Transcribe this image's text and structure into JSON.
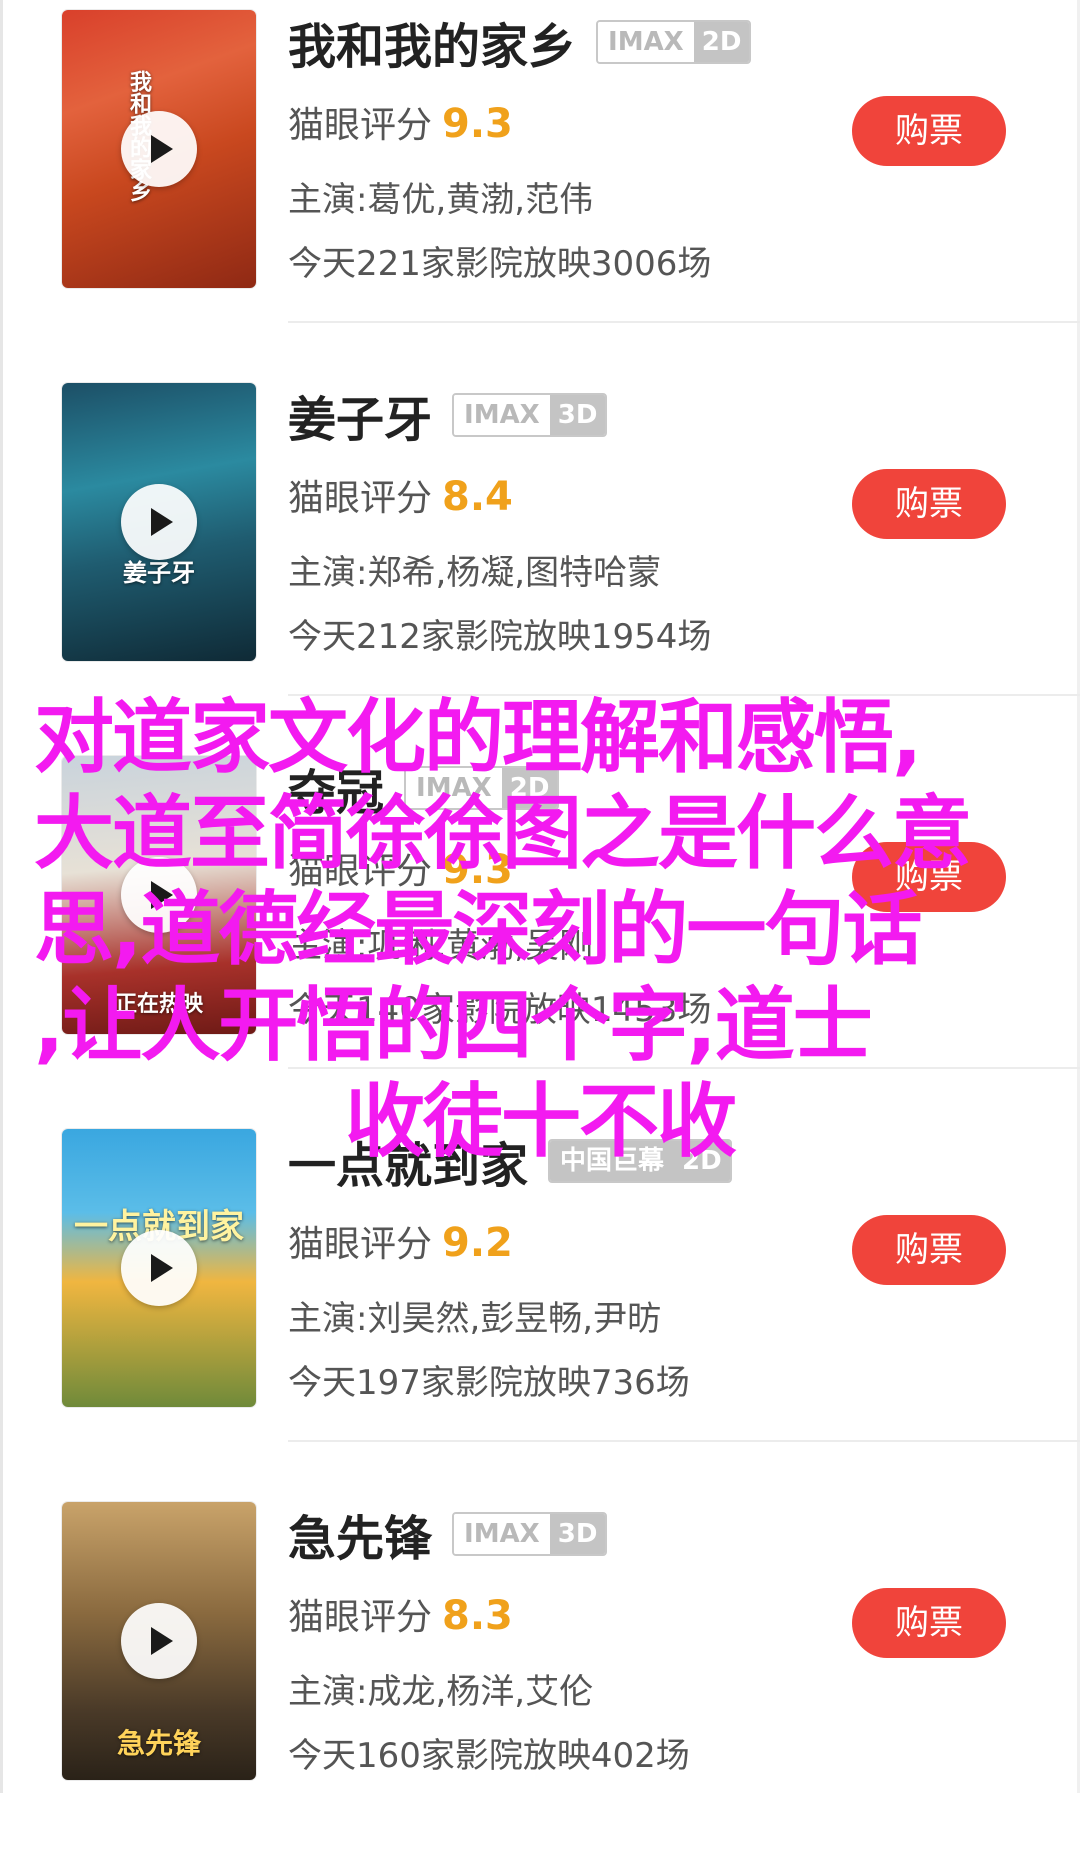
{
  "movies": [
    {
      "title": "我和我的家乡",
      "format": "IMAX",
      "dimension": "2D",
      "score_label": "猫眼评分",
      "score": "9.3",
      "cast": "主演:葛优,黄渤,范伟",
      "showings": "今天221家影院放映3006场",
      "buy_label": "购票",
      "poster_text": "我和我的家乡"
    },
    {
      "title": "姜子牙",
      "format": "IMAX",
      "dimension": "3D",
      "score_label": "猫眼评分",
      "score": "8.4",
      "cast": "主演:郑希,杨凝,图特哈蒙",
      "showings": "今天212家影院放映1954场",
      "buy_label": "购票",
      "poster_text": "姜子牙"
    },
    {
      "title": "夺冠",
      "format": "IMAX",
      "dimension": "2D",
      "score_label": "猫眼评分",
      "score": "9.3",
      "cast": "主演:巩俐,黄渤,吴刚",
      "showings": "今天140家影院放映1453场",
      "buy_label": "购票",
      "poster_text": "正在热映"
    },
    {
      "title": "一点就到家",
      "format": "中国巨幕",
      "dimension": "2D",
      "score_label": "猫眼评分",
      "score": "9.2",
      "cast": "主演:刘昊然,彭昱畅,尹昉",
      "showings": "今天197家影院放映736场",
      "buy_label": "购票",
      "poster_text": "一点就到家"
    },
    {
      "title": "急先锋",
      "format": "IMAX",
      "dimension": "3D",
      "score_label": "猫眼评分",
      "score": "8.3",
      "cast": "主演:成龙,杨洋,艾伦",
      "showings": "今天160家影院放映402场",
      "buy_label": "购票",
      "poster_text": "急先锋"
    }
  ],
  "overlay": {
    "line1": "对道家文化的理解和感悟,",
    "line2": "大道至简徐徐图之是什么意",
    "line3": "思,道德经最深刻的一句话",
    "line4": ",让人开悟的四个字,道士",
    "line5": "收徒十不收"
  },
  "colors": {
    "buy_button": "#f0443b",
    "score": "#f0a11b",
    "overlay_text": "#f31af0",
    "badge_gray": "#c4c4c4"
  },
  "icons": {
    "poster_play": "play-icon"
  }
}
